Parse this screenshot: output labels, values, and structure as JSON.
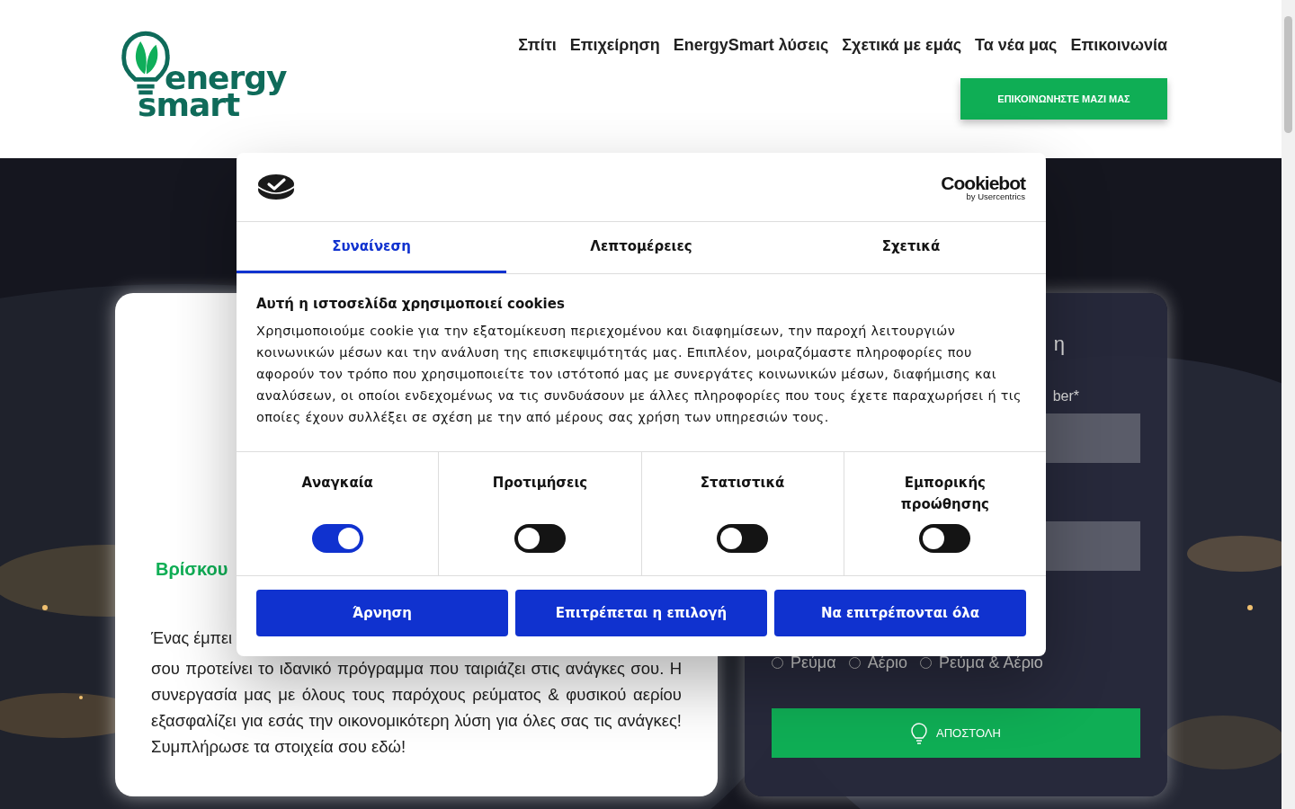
{
  "header": {
    "logo": {
      "line_1": "energy",
      "line_2": "smart"
    },
    "nav": [
      {
        "label": "Σπίτι"
      },
      {
        "label": "Επιχείρηση"
      },
      {
        "label": "EnergySmart λύσεις"
      },
      {
        "label": "Σχετικά με εμάς"
      },
      {
        "label": "Τα νέα μας"
      },
      {
        "label": "Επικοινωνία"
      }
    ],
    "cta": "ΕΠΙΚΟΙΝΩΝΗΣΤΕ ΜΑΖΙ ΜΑΣ"
  },
  "intro_card": {
    "heading": "Βρίσκου",
    "first_line": "Ένας έμπει",
    "paragraph": "σου προτείνει το ιδανικό πρόγραμμα που ταιριάζει στις ανάγκες σου. Η συνεργασία μας με όλους τους παρόχους ρεύματος & φυσικού αερίου εξασφαλίζει για εσάς την οικονομικότερη λύση για όλες σας τις ανάγκες!Συμπλήρωσε τα στοιχεία σου εδώ!"
  },
  "form_card": {
    "title": "η",
    "field_label": "ber*",
    "radios": [
      {
        "label": "Ρεύμα",
        "selected": false
      },
      {
        "label": "Αέριο",
        "selected": false
      },
      {
        "label": "Ρεύμα & Αέριο",
        "selected": false
      }
    ],
    "submit": "ΑΠΟΣΤΟΛΗ"
  },
  "cookie_dialog": {
    "brand": {
      "name": "Cookiebot",
      "byline": "by Usercentrics"
    },
    "tabs": [
      {
        "label": "Συναίνεση",
        "selected": true
      },
      {
        "label": "Λεπτομέρειες",
        "selected": false
      },
      {
        "label": "Σχετικά",
        "selected": false
      }
    ],
    "title": "Αυτή η ιστοσελίδα χρησιμοποιεί cookies",
    "text": "Χρησιμοποιούμε cookie για την εξατομίκευση περιεχομένου και διαφημίσεων, την παροχή λειτουργιών κοινωνικών μέσων και την ανάλυση της επισκεψιμότητάς μας. Επιπλέον, μοιραζόμαστε πληροφορίες που αφορούν τον τρόπο που χρησιμοποιείτε τον ιστότοπό μας με συνεργάτες κοινωνικών μέσων, διαφήμισης και αναλύσεων, οι οποίοι ενδεχομένως να τις συνδυάσουν με άλλες πληροφορίες που τους έχετε παραχωρήσει ή τις οποίες έχουν συλλέξει σε σχέση με την από μέρους σας χρήση των υπηρεσιών τους.",
    "categories": [
      {
        "label": "Αναγκαία",
        "on": true
      },
      {
        "label": "Προτιμήσεις",
        "on": false
      },
      {
        "label": "Στατιστικά",
        "on": false
      },
      {
        "label": "Εμπορικής προώθησης",
        "on": false
      }
    ],
    "buttons": [
      {
        "label": "Άρνηση"
      },
      {
        "label": "Επιτρέπεται η επιλογή"
      },
      {
        "label": "Να επιτρέπονται όλα"
      }
    ]
  }
}
